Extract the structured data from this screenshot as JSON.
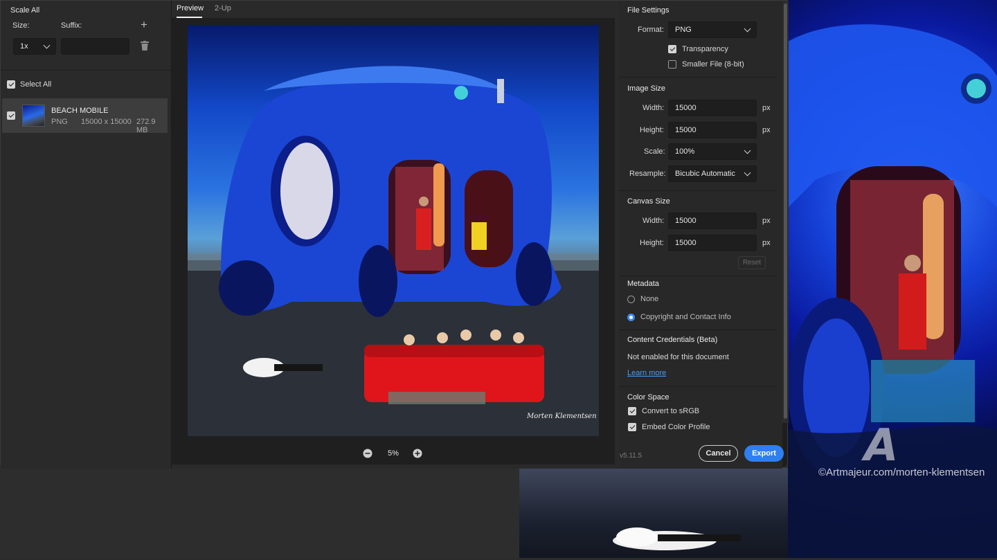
{
  "left_panel": {
    "scale_all_label": "Scale All",
    "size_label": "Size:",
    "suffix_label": "Suffix:",
    "size_value": "1x",
    "suffix_value": "",
    "select_all_label": "Select All",
    "asset": {
      "name": "BEACH MOBILE",
      "format": "PNG",
      "dimensions": "15000 x 15000",
      "filesize": "272.9 MB"
    }
  },
  "preview": {
    "tabs": [
      "Preview",
      "2-Up"
    ],
    "active_tab": "Preview",
    "zoom": "5%",
    "signature": "Morten Klementsen"
  },
  "file_settings": {
    "title": "File Settings",
    "format_label": "Format:",
    "format_value": "PNG",
    "transparency_label": "Transparency",
    "transparency_checked": true,
    "smaller_file_label": "Smaller File (8-bit)",
    "smaller_file_checked": false
  },
  "image_size": {
    "title": "Image Size",
    "width_label": "Width:",
    "width_value": "15000",
    "height_label": "Height:",
    "height_value": "15000",
    "unit": "px",
    "scale_label": "Scale:",
    "scale_value": "100%",
    "resample_label": "Resample:",
    "resample_value": "Bicubic Automatic"
  },
  "canvas_size": {
    "title": "Canvas Size",
    "width_label": "Width:",
    "width_value": "15000",
    "height_label": "Height:",
    "height_value": "15000",
    "unit": "px",
    "reset_label": "Reset"
  },
  "metadata": {
    "title": "Metadata",
    "option_none": "None",
    "option_copyright": "Copyright and Contact Info",
    "selected": "Copyright and Contact Info"
  },
  "content_credentials": {
    "title": "Content Credentials (Beta)",
    "status": "Not enabled for this document",
    "learn_more": "Learn more"
  },
  "color_space": {
    "title": "Color Space",
    "convert_label": "Convert to sRGB",
    "convert_checked": true,
    "embed_label": "Embed Color Profile",
    "embed_checked": true
  },
  "footer": {
    "version": "v5.11.5",
    "cancel_label": "Cancel",
    "export_label": "Export"
  },
  "watermark": {
    "text": "©Artmajeur.com/morten-klementsen"
  },
  "colors": {
    "accent": "#2f7ff0",
    "dialog_bg": "#1e1e1e",
    "panel_bg": "#2a2a2a"
  }
}
